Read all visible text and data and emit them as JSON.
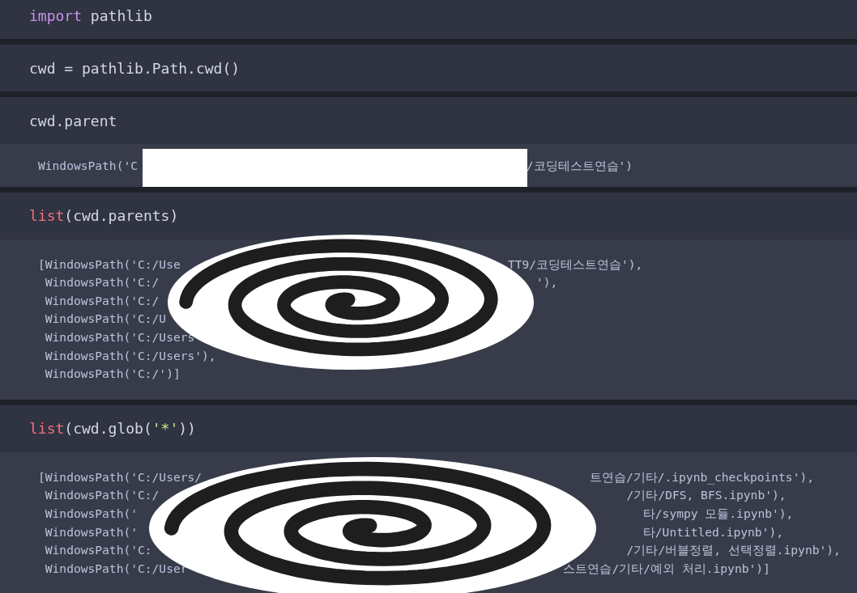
{
  "cells": [
    {
      "input": [
        {
          "kind": "keyword",
          "text": "import"
        },
        {
          "kind": "plain",
          "text": " pathlib"
        }
      ]
    },
    {
      "input": [
        {
          "kind": "plain",
          "text": "cwd = pathlib.Path.cwd()"
        }
      ]
    },
    {
      "input": [
        {
          "kind": "plain",
          "text": "cwd.parent"
        }
      ],
      "output": [
        {
          "left": "WindowsPath('C",
          "right": "/코딩테스트연습')"
        }
      ]
    },
    {
      "input": [
        {
          "kind": "builtin",
          "text": "list"
        },
        {
          "kind": "plain",
          "text": "(cwd.parents)"
        }
      ],
      "output": [
        {
          "left": "[WindowsPath('C:/Use",
          "right": "TT9/코딩테스트연습'),"
        },
        {
          "left": " WindowsPath('C:/",
          "right": "'),"
        },
        {
          "left": " WindowsPath('C:/"
        },
        {
          "left": " WindowsPath('C:/U"
        },
        {
          "left": " WindowsPath('C:/Users"
        },
        {
          "left": " WindowsPath('C:/Users'),"
        },
        {
          "left": " WindowsPath('C:/')]"
        }
      ]
    },
    {
      "input": [
        {
          "kind": "builtin",
          "text": "list"
        },
        {
          "kind": "plain",
          "text": "(cwd.glob("
        },
        {
          "kind": "string",
          "text": "'*'"
        },
        {
          "kind": "plain",
          "text": "))"
        }
      ],
      "output": [
        {
          "left": "[WindowsPath('C:/Users/",
          "right": "트연습/기타/.ipynb_checkpoints'),"
        },
        {
          "left": " WindowsPath('C:/",
          "right": "/기타/DFS, BFS.ipynb'),"
        },
        {
          "left": " WindowsPath('",
          "right": "타/sympy 모듈.ipynb'),"
        },
        {
          "left": " WindowsPath('",
          "right": "타/Untitled.ipynb'),"
        },
        {
          "left": " WindowsPath('C:",
          "right": "/기타/버블정렬, 선택정렬.ipynb'),"
        },
        {
          "left": " WindowsPath('C:/User",
          "right": "스트연습/기타/예외 처리.ipynb')]"
        }
      ]
    }
  ]
}
